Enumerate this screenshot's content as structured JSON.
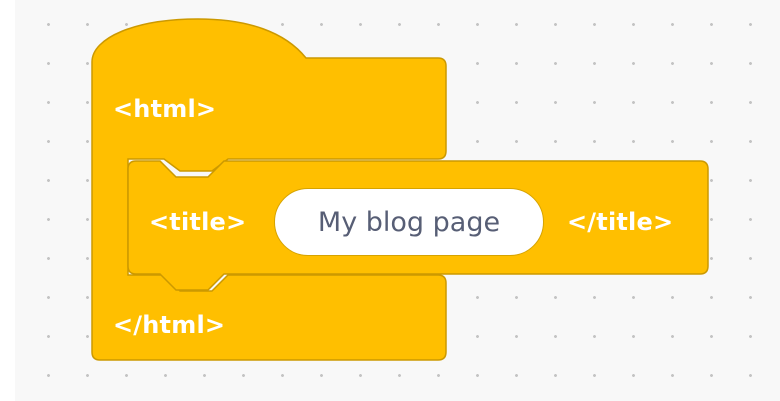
{
  "colors": {
    "block_fill": "#ffbf00",
    "block_border": "#cc9900",
    "workspace_bg": "#f8f8f8",
    "input_text": "#575e75"
  },
  "html_block": {
    "open_label": "<html>",
    "close_label": "</html>"
  },
  "title_block": {
    "open_label": "<title>",
    "value": "My blog page",
    "close_label": "</title>"
  }
}
